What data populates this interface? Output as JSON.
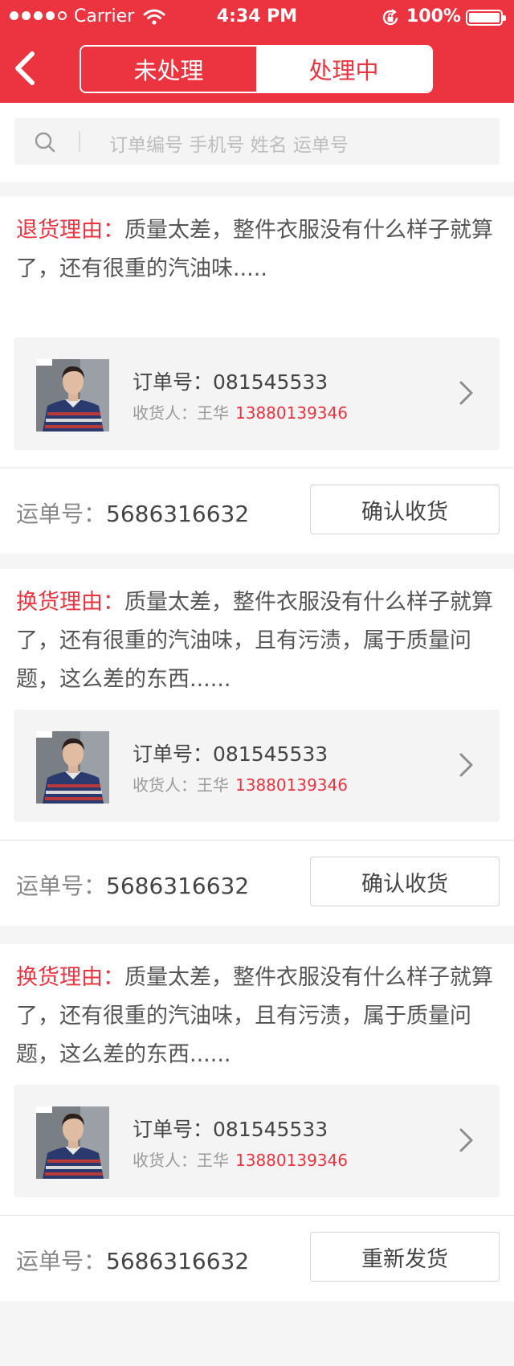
{
  "status_bar": {
    "carrier": "Carrier",
    "time": "4:34 PM",
    "battery": "100%"
  },
  "header": {
    "tabs": [
      "未处理",
      "处理中"
    ]
  },
  "search": {
    "placeholder": "订单编号 手机号 姓名  运单号"
  },
  "colors": {
    "brand": "#ec3340",
    "page_bg": "#f5f5f5",
    "card_bg": "#ffffff",
    "product_bg": "#f4f4f4"
  },
  "orders": [
    {
      "reason_label": "退货理由：",
      "reason_text": "质量太差，整件衣服没有什么样子就算了，还有很重的汽油味.....",
      "order_label": "订单号：",
      "order_no": "081545533",
      "consignee_label": "收货人：",
      "consignee_name": "王华",
      "phone": "13880139346",
      "waybill_label": "运单号：",
      "waybill_no": "5686316632",
      "action": "确认收货"
    },
    {
      "reason_label": "换货理由：",
      "reason_text": "质量太差，整件衣服没有什么样子就算了，还有很重的汽油味，且有污渍，属于质量问题，这么差的东西......",
      "order_label": "订单号：",
      "order_no": "081545533",
      "consignee_label": "收货人：",
      "consignee_name": "王华",
      "phone": "13880139346",
      "waybill_label": "运单号：",
      "waybill_no": "5686316632",
      "action": "确认收货"
    },
    {
      "reason_label": "换货理由：",
      "reason_text": "质量太差，整件衣服没有什么样子就算了，还有很重的汽油味，且有污渍，属于质量问题，这么差的东西......",
      "order_label": "订单号：",
      "order_no": "081545533",
      "consignee_label": "收货人：",
      "consignee_name": "王华",
      "phone": "13880139346",
      "waybill_label": "运单号：",
      "waybill_no": "5686316632",
      "action": "重新发货"
    }
  ]
}
